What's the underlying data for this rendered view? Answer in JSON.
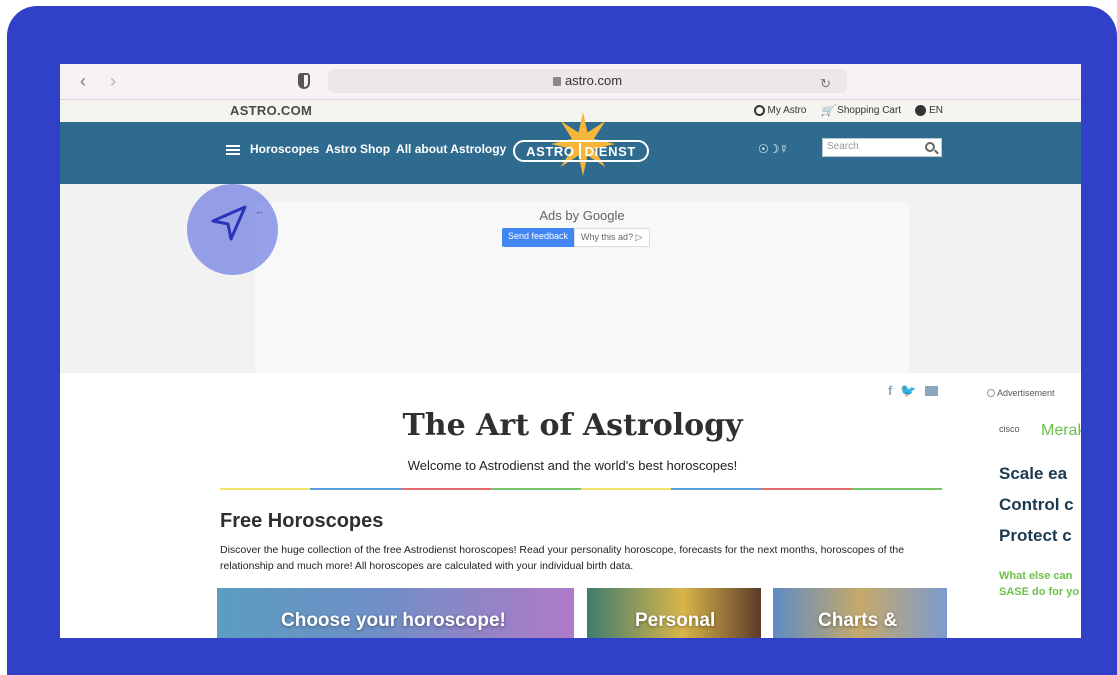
{
  "browser": {
    "url": "astro.com"
  },
  "topbar": {
    "brand": "ASTRO.COM",
    "my_astro": "My Astro",
    "shopping_cart": "Shopping Cart",
    "language": "EN"
  },
  "header": {
    "nav": [
      "Horoscopes",
      "Astro Shop",
      "All about Astrology"
    ],
    "logo_left": "ASTRO",
    "logo_right": "DIENST",
    "planet_symbols": "☉☽☿",
    "search_placeholder": "Search"
  },
  "ad_banner": {
    "ads_by": "Ads by",
    "google": "Google",
    "send_feedback": "Send feedback",
    "why_this_ad": "Why this ad? ▷"
  },
  "main": {
    "social": [
      "f",
      "🐦"
    ],
    "title": "The Art of Astrology",
    "subtitle": "Welcome to Astrodienst and the world's best horoscopes!",
    "rainbow_colors": [
      "#f2e26b",
      "#5aa0e0",
      "#e36b6b",
      "#7cc46a",
      "#f2e26b",
      "#5aa0e0",
      "#e36b6b",
      "#7cc46a"
    ],
    "section_title": "Free Horoscopes",
    "description": "Discover the huge collection of the free Astrodienst horoscopes! Read your personality horoscope, forecasts for the next months, horoscopes of the relationship and much more! All horoscopes are calculated with your individual birth data.",
    "cards": [
      "Choose your horoscope!",
      "Personal",
      "Charts &"
    ]
  },
  "side_ad": {
    "label": "Advertisement",
    "cisco": "cisco",
    "meraki": "Merak",
    "lines": [
      "Scale ea",
      "Control c",
      "Protect c"
    ],
    "small": [
      "What else can",
      "SASE do for yo"
    ]
  },
  "colors": {
    "frame": "#3040c8",
    "header": "#2f6b8f",
    "accent_sun": "#f6b63a"
  }
}
